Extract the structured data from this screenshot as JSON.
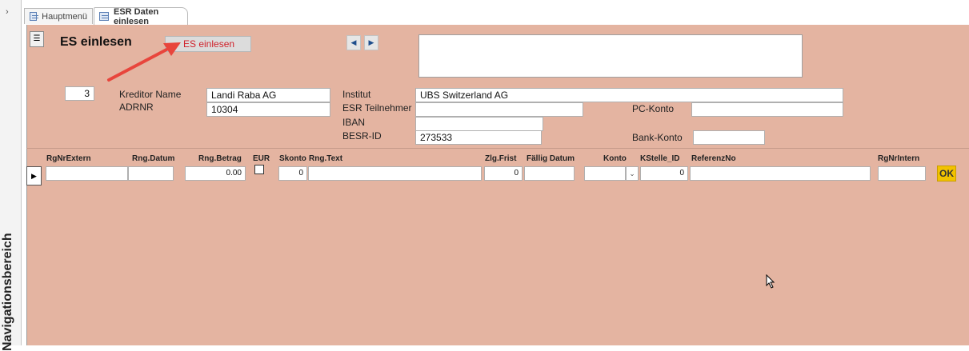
{
  "navigation_pane": {
    "label": "Navigationsbereich",
    "toggle_icon": "chevron-right-icon"
  },
  "tabs": [
    {
      "label": "Hauptmenü",
      "icon": "form-icon"
    },
    {
      "label": "ESR Daten einlesen",
      "icon": "form-icon",
      "active": true
    }
  ],
  "form": {
    "title": "ES einlesen",
    "es_button_label": "ES einlesen",
    "record_nav": {
      "prev": "◀",
      "next": "▶"
    },
    "memo_text": "",
    "counter": "3",
    "kreditor_name_label": "Kreditor Name",
    "kreditor_name": "Landi Raba AG",
    "adrnr_label": "ADRNR",
    "adrnr": "10304",
    "institut_label": "Institut",
    "institut": "UBS Switzerland AG",
    "esr_teilnehmer_label": "ESR Teilnehmer",
    "esr_teilnehmer": "",
    "iban_label": "IBAN",
    "iban": "",
    "besr_id_label": "BESR-ID",
    "besr_id": "273533",
    "pc_konto_label": "PC-Konto",
    "pc_konto": "",
    "bank_konto_label": "Bank-Konto",
    "bank_konto": ""
  },
  "grid": {
    "columns": [
      "RgNrExtern",
      "Rng.Datum",
      "Rng.Betrag",
      "EUR",
      "Skonto",
      "Rng.Text",
      "Zlg.Frist",
      "Fällig Datum",
      "Konto",
      "KStelle_ID",
      "ReferenzNo",
      "RgNrIntern"
    ],
    "row": {
      "rgnr_extern": "",
      "rng_datum": "",
      "rng_betrag": "0.00",
      "eur": false,
      "skonto": "0",
      "rng_text": "",
      "zlg_frist": "0",
      "faellig_datum": "",
      "konto": "",
      "kstelle_id": "0",
      "referenz_no": "",
      "rgnr_intern": ""
    },
    "ok_label": "OK"
  },
  "colors": {
    "form_background": "#e4b4a1",
    "ok_button": "#f2c200",
    "annotation_arrow": "#e8453c",
    "es_button_text": "#d0202a"
  }
}
